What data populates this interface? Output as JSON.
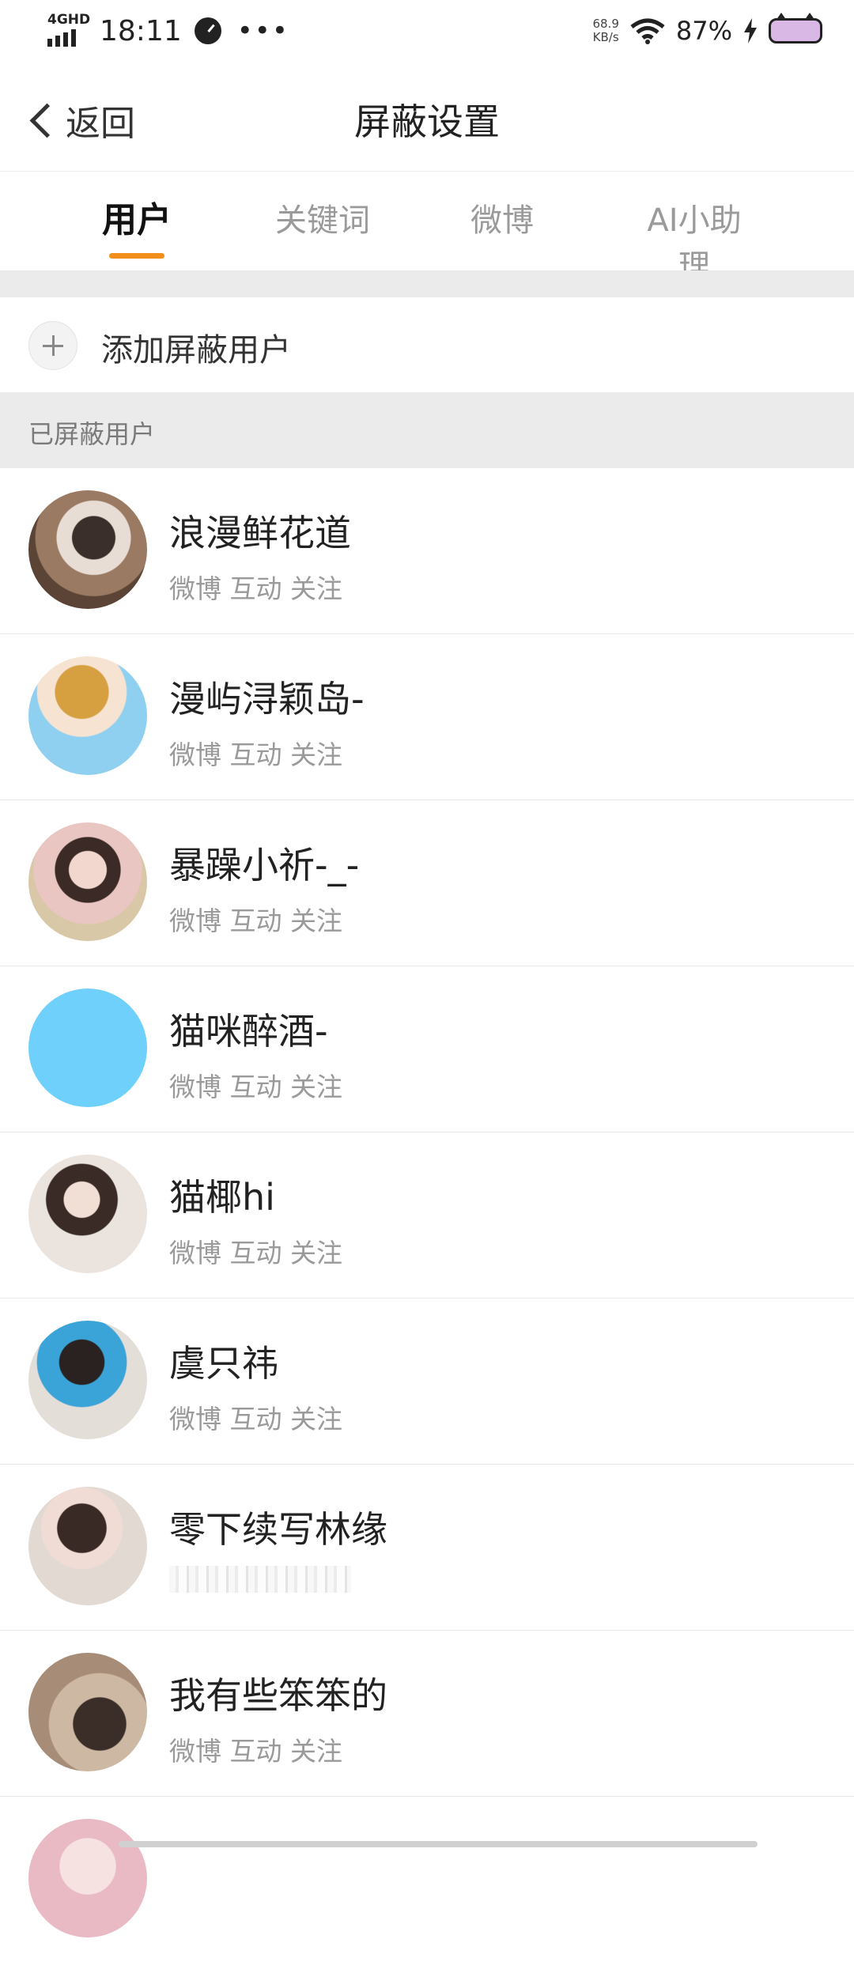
{
  "status_bar": {
    "network": "4GHD",
    "time": "18:11",
    "speed_value": "68.9",
    "speed_unit": "KB/s",
    "battery": "87%"
  },
  "nav": {
    "back_label": "返回",
    "title": "屏蔽设置"
  },
  "tabs": [
    {
      "label": "用户",
      "active": true
    },
    {
      "label": "关键词",
      "active": false
    },
    {
      "label": "微博",
      "active": false
    },
    {
      "label": "AI小助理",
      "active": false
    }
  ],
  "add_user": {
    "label": "添加屏蔽用户"
  },
  "section_header": "已屏蔽用户",
  "users": [
    {
      "name": "浪漫鲜花道",
      "sub": "微博 互动 关注"
    },
    {
      "name": "漫屿浔颖岛-",
      "sub": "微博 互动 关注"
    },
    {
      "name": "暴躁小祈-_-",
      "sub": "微博 互动 关注"
    },
    {
      "name": "猫咪醉酒-",
      "sub": "微博 互动 关注"
    },
    {
      "name": "猫椰hi",
      "sub": "微博 互动 关注"
    },
    {
      "name": "虞只祎",
      "sub": "微博 互动 关注"
    },
    {
      "name": "零下续写林缘",
      "sub": ""
    },
    {
      "name": "我有些笨笨的",
      "sub": "微博 互动 关注"
    }
  ],
  "colors": {
    "accent": "#f28e1c",
    "section_bg": "#ebebeb",
    "muted_text": "#9a9a9a"
  }
}
